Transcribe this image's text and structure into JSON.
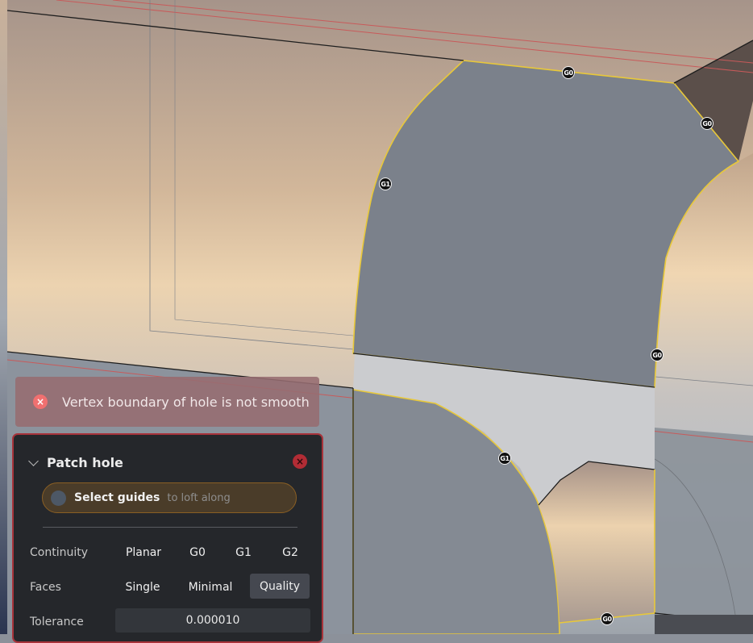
{
  "viewport": {
    "edge_continuity_labels": [
      "G0",
      "G0",
      "G1",
      "G0",
      "G1",
      "G0"
    ]
  },
  "error_toast": {
    "message": "Vertex boundary of hole is not smooth"
  },
  "panel": {
    "title": "Patch hole",
    "select_guides": {
      "label": "Select guides",
      "hint": "to loft along"
    },
    "continuity": {
      "label": "Continuity",
      "options": [
        "Planar",
        "G0",
        "G1",
        "G2"
      ]
    },
    "faces": {
      "label": "Faces",
      "options": [
        "Single",
        "Minimal",
        "Quality"
      ],
      "selected": "Quality"
    },
    "tolerance": {
      "label": "Tolerance",
      "value": "0.000010"
    }
  },
  "colors": {
    "error_red": "#a8333b",
    "edge_highlight": "#e8c83a",
    "guide_accent": "#8a5f24"
  }
}
